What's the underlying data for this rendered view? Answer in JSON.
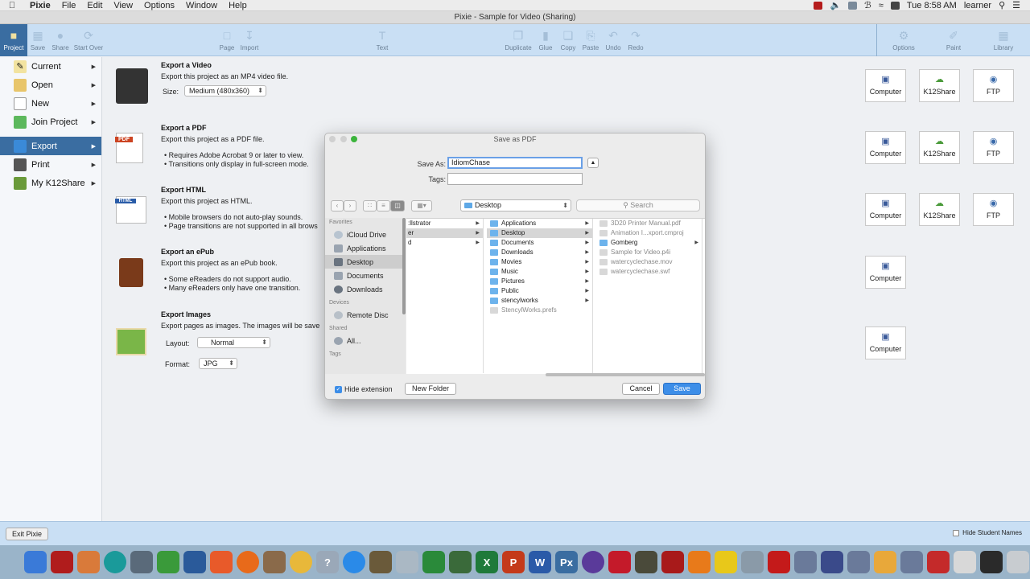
{
  "menubar": {
    "app": "Pixie",
    "items": [
      "File",
      "Edit",
      "View",
      "Options",
      "Window",
      "Help"
    ],
    "clock": "Tue 8:58 AM",
    "user": "learner"
  },
  "window_title": "Pixie - Sample for Video (Sharing)",
  "toolbar": {
    "project": "Project",
    "save": "Save",
    "share": "Share",
    "start_over": "Start Over",
    "page": "Page",
    "import": "Import",
    "text": "Text",
    "duplicate": "Duplicate",
    "glue": "Glue",
    "copy": "Copy",
    "paste": "Paste",
    "undo": "Undo",
    "redo": "Redo",
    "options": "Options",
    "paint": "Paint",
    "library": "Library"
  },
  "leftnav": {
    "items": [
      {
        "label": "Current"
      },
      {
        "label": "Open"
      },
      {
        "label": "New"
      },
      {
        "label": "Join Project"
      },
      {
        "label": "Export"
      },
      {
        "label": "Print"
      },
      {
        "label": "My K12Share"
      }
    ]
  },
  "sections": {
    "video": {
      "title": "Export a Video",
      "desc": "Export this project as an MP4 video file.",
      "size_label": "Size:",
      "size_value": "Medium (480x360)"
    },
    "pdf": {
      "title": "Export a PDF",
      "desc": "Export this project as a PDF file.",
      "note1": "• Requires Adobe Acrobat 9 or later to view.",
      "note2": "• Transitions only display in full-screen mode.",
      "icon_text": "PDF"
    },
    "html": {
      "title": "Export HTML",
      "desc": "Export this project as HTML.",
      "note1": "• Mobile browsers do not auto-play sounds.",
      "note2": "• Page transitions are not supported in all brows",
      "icon_text": "HTML"
    },
    "epub": {
      "title": "Export an ePub",
      "desc": "Export this project as an ePub book.",
      "note1": "• Some eReaders do not support audio.",
      "note2": "• Many eReaders only have one transition."
    },
    "images": {
      "title": "Export Images",
      "desc": "Export pages as images. The images will be save",
      "layout_label": "Layout:",
      "layout_value": "Normal",
      "format_label": "Format:",
      "format_value": "JPG"
    }
  },
  "destinations": {
    "computer": "Computer",
    "k12share": "K12Share",
    "ftp": "FTP"
  },
  "dialog": {
    "title": "Save as PDF",
    "save_as_label": "Save As:",
    "save_as_value": "IdiomChase",
    "tags_label": "Tags:",
    "path": "Desktop",
    "search_placeholder": "Search",
    "sidebar": {
      "favorites_head": "Favorites",
      "favorites": [
        "iCloud Drive",
        "Applications",
        "Desktop",
        "Documents",
        "Downloads"
      ],
      "devices_head": "Devices",
      "devices": [
        "Remote Disc"
      ],
      "shared_head": "Shared",
      "shared": [
        "All..."
      ],
      "tags_head": "Tags"
    },
    "col1": [
      ":llstrator",
      "er",
      "d"
    ],
    "col2": [
      {
        "name": "Applications",
        "folder": true
      },
      {
        "name": "Desktop",
        "folder": true
      },
      {
        "name": "Documents",
        "folder": true
      },
      {
        "name": "Downloads",
        "folder": true
      },
      {
        "name": "Movies",
        "folder": true
      },
      {
        "name": "Music",
        "folder": true
      },
      {
        "name": "Pictures",
        "folder": true
      },
      {
        "name": "Public",
        "folder": true
      },
      {
        "name": "stencylworks",
        "folder": true
      },
      {
        "name": "StencylWorks.prefs",
        "folder": false
      }
    ],
    "col3": [
      {
        "name": "3D20 Printer Manual.pdf",
        "folder": false
      },
      {
        "name": "Animation I...xport.cmproj",
        "folder": false
      },
      {
        "name": "Gomberg",
        "folder": true
      },
      {
        "name": "Sample for Video.p4i",
        "folder": false
      },
      {
        "name": "watercyclechase.mov",
        "folder": false
      },
      {
        "name": "watercyclechase.swf",
        "folder": false
      }
    ],
    "hide_extension": "Hide extension",
    "new_folder": "New Folder",
    "cancel": "Cancel",
    "save": "Save"
  },
  "bottombar": {
    "exit": "Exit Pixie",
    "hide_names": "Hide Student Names"
  },
  "colors": {
    "toolbar_bg": "#c9dff4",
    "nav_active": "#3a6da1",
    "primary_button": "#3d8ee8"
  }
}
